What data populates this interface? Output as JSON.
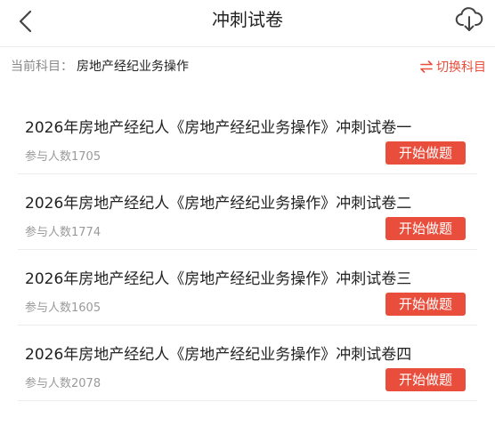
{
  "header": {
    "title": "冲刺试卷",
    "back_icon": "chevron-left-icon",
    "download_icon": "cloud-download-icon"
  },
  "subject": {
    "label": "当前科目：",
    "value": "房地产经纪业务操作",
    "switch_label": "切换科目",
    "switch_icon": "swap-arrows-icon"
  },
  "papers": [
    {
      "title": "2026年房地产经纪人《房地产经纪业务操作》冲刺试卷一",
      "count": "参与人数1705",
      "button": "开始做题"
    },
    {
      "title": "2026年房地产经纪人《房地产经纪业务操作》冲刺试卷二",
      "count": "参与人数1774",
      "button": "开始做题"
    },
    {
      "title": "2026年房地产经纪人《房地产经纪业务操作》冲刺试卷三",
      "count": "参与人数1605",
      "button": "开始做题"
    },
    {
      "title": "2026年房地产经纪人《房地产经纪业务操作》冲刺试卷四",
      "count": "参与人数2078",
      "button": "开始做题"
    }
  ],
  "colors": {
    "accent": "#e94e3c",
    "text": "#222222",
    "muted": "#9a9a9a",
    "divider": "#ececec"
  }
}
